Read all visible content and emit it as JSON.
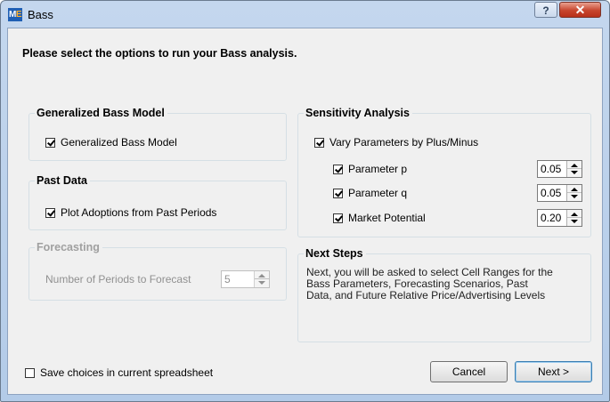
{
  "window": {
    "title": "Bass",
    "icon_text": "ME",
    "help_glyph": "?",
    "close_glyph": "✕"
  },
  "prompt": "Please select the options to run your Bass analysis.",
  "generalized": {
    "title": "Generalized Bass Model",
    "checkbox_label": "Generalized Bass Model",
    "checked": true
  },
  "past_data": {
    "title": "Past Data",
    "checkbox_label": "Plot Adoptions from Past Periods",
    "checked": true
  },
  "forecasting": {
    "title": "Forecasting",
    "label": "Number of Periods to Forecast",
    "value": "5",
    "enabled": false
  },
  "sensitivity": {
    "title": "Sensitivity Analysis",
    "vary_label": "Vary Parameters by Plus/Minus",
    "vary_checked": true,
    "params": [
      {
        "label": "Parameter p",
        "value": "0.05",
        "checked": true
      },
      {
        "label": "Parameter q",
        "value": "0.05",
        "checked": true
      },
      {
        "label": "Market Potential",
        "value": "0.20",
        "checked": true
      }
    ]
  },
  "next_steps": {
    "title": "Next Steps",
    "line1": "Next, you will be asked to select Cell Ranges for the",
    "line2": "Bass Parameters, Forecasting Scenarios, Past",
    "line3": "Data, and Future Relative Price/Advertising Levels"
  },
  "footer": {
    "save_label": "Save choices in current spreadsheet",
    "save_checked": false,
    "cancel_label": "Cancel",
    "next_label": "Next >"
  },
  "colors": {
    "title_bar": "#b9d0ea",
    "close_button": "#c7452d",
    "dialog_bg": "#f0f0f0"
  }
}
